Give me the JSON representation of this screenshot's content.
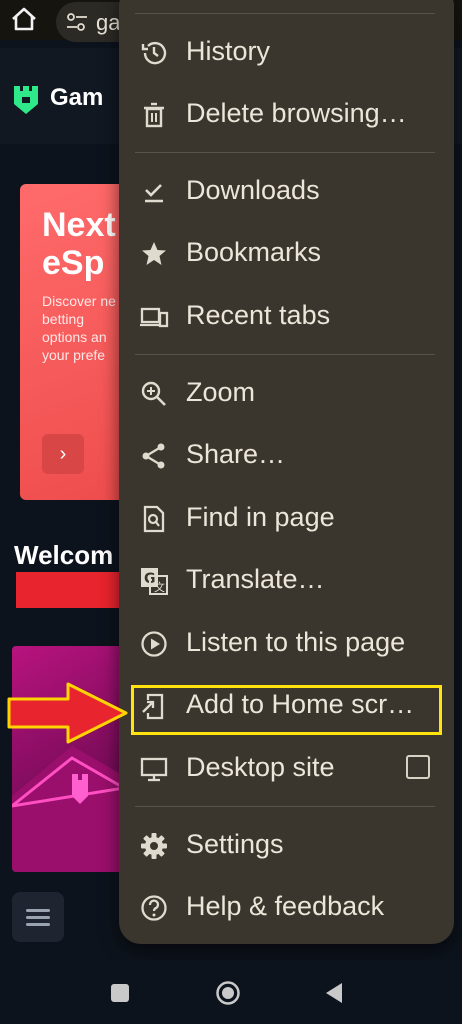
{
  "browser": {
    "url_text": "ga"
  },
  "site": {
    "logo_text": "Gam",
    "promo_title_line1": "Next",
    "promo_title_line2": "eSp",
    "promo_desc_line1": "Discover ne",
    "promo_desc_line2": "betting",
    "promo_desc_line3": "options an",
    "promo_desc_line4": "your prefe",
    "promo_button_glyph": "›",
    "welcome_text": "Welcom"
  },
  "menu": {
    "items": [
      {
        "label": "History",
        "icon": "history-icon"
      },
      {
        "label": "Delete browsing…",
        "icon": "trash-icon"
      },
      {
        "label": "Downloads",
        "icon": "download-check-icon"
      },
      {
        "label": "Bookmarks",
        "icon": "star-icon"
      },
      {
        "label": "Recent tabs",
        "icon": "devices-icon"
      },
      {
        "label": "Zoom",
        "icon": "zoom-in-icon"
      },
      {
        "label": "Share…",
        "icon": "share-icon"
      },
      {
        "label": "Find in page",
        "icon": "find-in-page-icon"
      },
      {
        "label": "Translate…",
        "icon": "translate-icon"
      },
      {
        "label": "Listen to this page",
        "icon": "play-circle-icon"
      },
      {
        "label": "Add to Home scr…",
        "icon": "add-to-home-icon"
      },
      {
        "label": "Desktop site",
        "icon": "monitor-icon",
        "checkbox": false
      },
      {
        "label": "Settings",
        "icon": "gear-icon"
      },
      {
        "label": "Help & feedback",
        "icon": "help-icon"
      }
    ]
  },
  "colors": {
    "menu_bg": "#3a362d",
    "highlight": "#ffe30f",
    "arrow_fill": "#e8242e",
    "arrow_stroke": "#ffd400",
    "promo": "#f55a5a"
  }
}
